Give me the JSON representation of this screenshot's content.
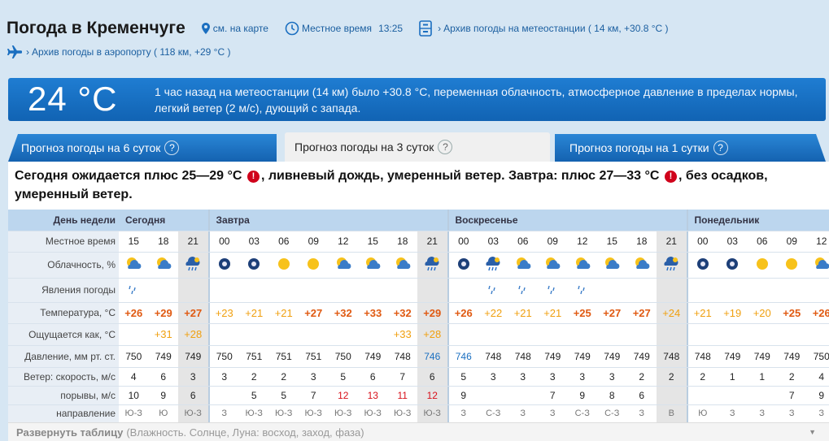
{
  "header": {
    "title": "Погода в Кременчуге",
    "map_link": "см. на карте",
    "local_time_label": "Местное время",
    "local_time": "13:25",
    "station_archive": "Архив погоды на метеостанции ( 14 км, +30.8 °C )",
    "airport_archive": "Архив погоды в аэропорту ( 118 км, +29 °C )"
  },
  "current": {
    "temp": "24 °C",
    "description": "1 час назад на метеостанции (14 км) было +30.8 °C, переменная облачность, атмосферное давление в пределах нормы, легкий ветер (2 м/с), дующий с запада."
  },
  "tabs": [
    {
      "label": "Прогноз погоды на 6 суток"
    },
    {
      "label": "Прогноз погоды на 3 суток"
    },
    {
      "label": "Прогноз погоды на 1 сутки"
    }
  ],
  "summary": {
    "part1": "Сегодня ожидается плюс 25—29 °C",
    "part2": ", ливневый дождь, умеренный ветер. Завтра: плюс 27—33 °C",
    "part3": ", без осадков, умеренный ветер."
  },
  "table": {
    "day_label": "День недели",
    "days": [
      "Сегодня",
      "Завтра",
      "Воскресенье",
      "Понедельник"
    ],
    "row_labels": [
      "Местное время",
      "Облачность, %",
      "Явления погоды",
      "Температура, °C",
      "Ощущается как, °C",
      "Давление, мм рт. ст.",
      "Ветер: скорость, м/с",
      "порывы, м/с",
      "направление"
    ],
    "hours": [
      "15",
      "18",
      "21",
      "00",
      "03",
      "06",
      "09",
      "12",
      "15",
      "18",
      "21",
      "00",
      "03",
      "06",
      "09",
      "12",
      "15",
      "18",
      "21",
      "00",
      "03",
      "06",
      "09",
      "12"
    ],
    "temps": [
      "+26",
      "+29",
      "+27",
      "+23",
      "+21",
      "+21",
      "+27",
      "+32",
      "+33",
      "+32",
      "+29",
      "+26",
      "+22",
      "+21",
      "+21",
      "+25",
      "+27",
      "+27",
      "+24",
      "+21",
      "+19",
      "+20",
      "+25",
      "+26"
    ],
    "feels": [
      "",
      "+31",
      "+28",
      "",
      "",
      "",
      "",
      "",
      "",
      "+33",
      "+28",
      "",
      "",
      "",
      "",
      "",
      "",
      "",
      "",
      "",
      "",
      "",
      "",
      ""
    ],
    "pressure": [
      "750",
      "749",
      "749",
      "750",
      "751",
      "751",
      "751",
      "750",
      "749",
      "748",
      "746",
      "746",
      "748",
      "748",
      "749",
      "749",
      "749",
      "749",
      "748",
      "748",
      "749",
      "749",
      "749",
      "750"
    ],
    "wind": [
      "4",
      "6",
      "3",
      "3",
      "2",
      "2",
      "3",
      "5",
      "6",
      "7",
      "6",
      "5",
      "3",
      "3",
      "3",
      "3",
      "3",
      "2",
      "2",
      "2",
      "1",
      "1",
      "2",
      "4"
    ],
    "gusts": [
      "10",
      "9",
      "6",
      "",
      "5",
      "5",
      "7",
      "12",
      "13",
      "11",
      "12",
      "9",
      "",
      "",
      "7",
      "9",
      "8",
      "6",
      "",
      "",
      "",
      "",
      "7",
      "9"
    ],
    "direction": [
      "Ю-З",
      "Ю",
      "Ю-З",
      "З",
      "Ю-З",
      "Ю-З",
      "Ю-З",
      "Ю-З",
      "Ю-З",
      "Ю-З",
      "Ю-З",
      "З",
      "С-З",
      "З",
      "З",
      "С-З",
      "С-З",
      "З",
      "В",
      "Ю",
      "З",
      "З",
      "З",
      "З"
    ]
  },
  "footer": {
    "expand": "Развернуть таблицу",
    "details": "(Влажность. Солнце, Луна: восход, заход, фаза)"
  },
  "colors": {
    "banner": "#1567b8",
    "temp_hot": "#e05a12",
    "temp_warm": "#f0a010",
    "gust_red": "#d8101a"
  }
}
